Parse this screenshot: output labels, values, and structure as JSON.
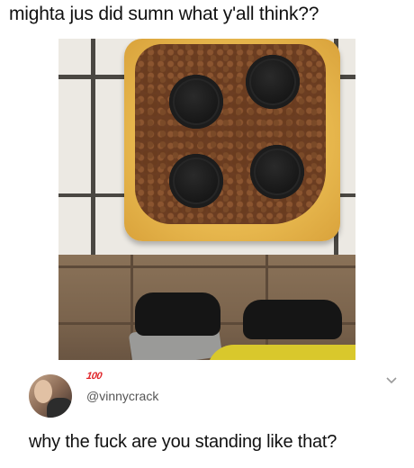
{
  "post": {
    "title": "mighta jus did sumn what y'all think??"
  },
  "reply": {
    "emoji": "💯",
    "emoji_text": "100",
    "handle": "@vinnycrack",
    "text": "why the fuck are you standing like that?",
    "icons": [
      "avatar",
      "chevron-down-icon"
    ]
  },
  "colors": {
    "text": "#111111",
    "handle": "#555555",
    "emoji_red": "#e0262b"
  }
}
